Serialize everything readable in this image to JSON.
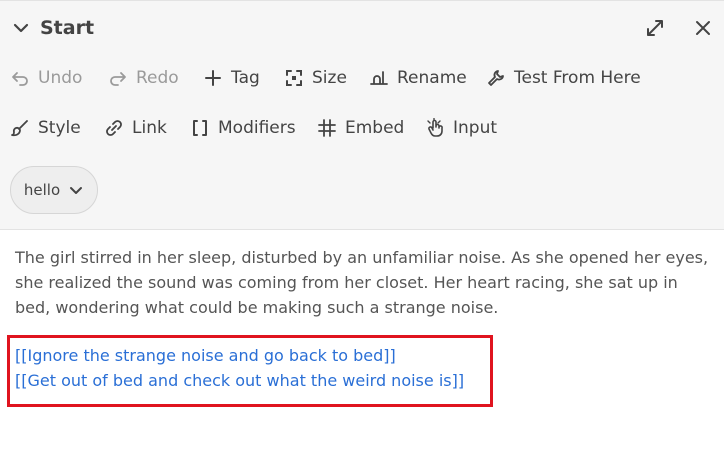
{
  "header": {
    "title": "Start"
  },
  "toolbar": {
    "undo": "Undo",
    "redo": "Redo",
    "tag": "Tag",
    "size": "Size",
    "rename": "Rename",
    "test_from_here": "Test From Here",
    "style": "Style",
    "link": "Link",
    "modifiers": "Modifiers",
    "embed": "Embed",
    "input": "Input"
  },
  "tags": {
    "selected": "hello"
  },
  "passage": {
    "text": "The girl stirred in her sleep, disturbed by an unfamiliar noise. As she opened her eyes, she realized the sound was coming from her closet. Her heart racing, she sat up in bed, wondering what could be making such a strange noise.",
    "links": [
      "[[Ignore the strange noise and go back to bed]]",
      "[[Get out of bed and check out what the weird noise is]]"
    ]
  },
  "colors": {
    "link": "#2a6fd6",
    "highlight": "#e0141f"
  }
}
